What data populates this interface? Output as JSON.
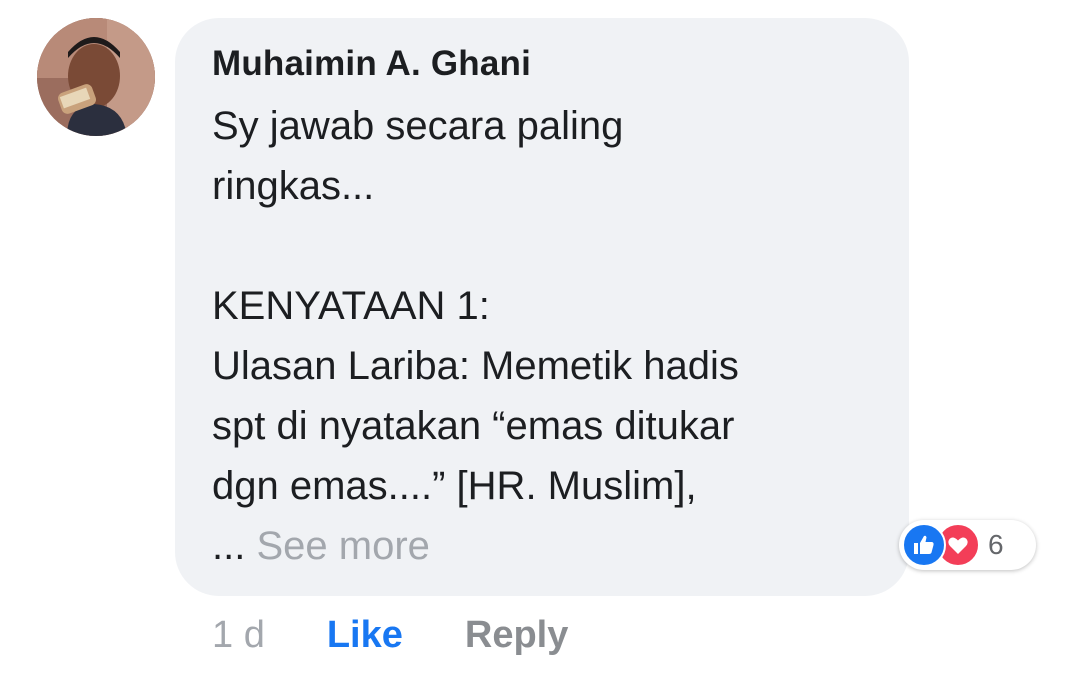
{
  "comment": {
    "author": "Muhaimin A. Ghani",
    "lines": [
      "Sy jawab secara paling",
      "ringkas...",
      "",
      "KENYATAAN 1:",
      "Ulasan Lariba: Memetik hadis",
      "spt di nyatakan “emas ditukar",
      "dgn emas....” [HR. Muslim],"
    ],
    "ellipsis": "...",
    "see_more_label": "See more"
  },
  "reactions": {
    "types": [
      "like-icon",
      "love-icon"
    ],
    "count": "6",
    "like_color": "#1877f2",
    "love_color": "#f33e58"
  },
  "actions": {
    "time": "1 d",
    "like_label": "Like",
    "reply_label": "Reply",
    "like_color": "#1877f2"
  }
}
